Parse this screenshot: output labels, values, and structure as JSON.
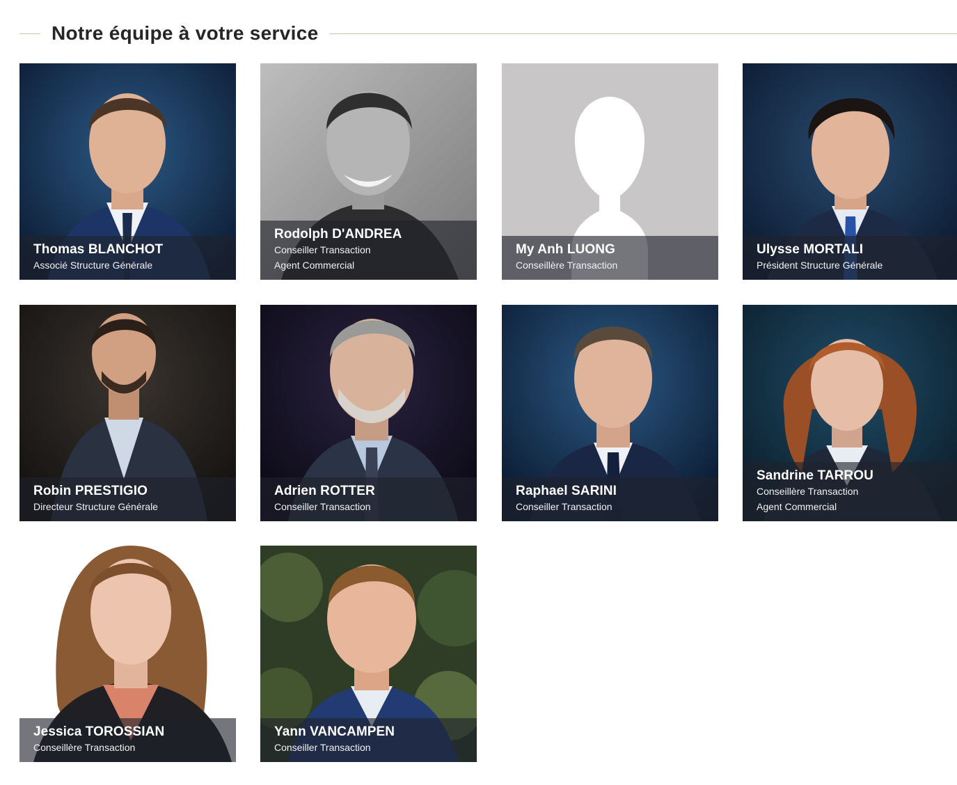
{
  "section": {
    "title": "Notre équipe à votre service"
  },
  "members": [
    {
      "name": "Thomas BLANCHOT",
      "roles": [
        "Associé Structure Générale"
      ]
    },
    {
      "name": "Rodolph D'ANDREA",
      "roles": [
        "Conseiller Transaction",
        "Agent Commercial"
      ]
    },
    {
      "name": "My Anh LUONG",
      "roles": [
        "Conseillère Transaction"
      ]
    },
    {
      "name": "Ulysse MORTALI",
      "roles": [
        "Président Structure Générale"
      ]
    },
    {
      "name": "Robin PRESTIGIO",
      "roles": [
        "Directeur Structure Générale"
      ]
    },
    {
      "name": "Adrien ROTTER",
      "roles": [
        "Conseiller Transaction"
      ]
    },
    {
      "name": "Raphael SARINI",
      "roles": [
        "Conseiller Transaction"
      ]
    },
    {
      "name": "Sandrine TARROU",
      "roles": [
        "Conseillère Transaction",
        "Agent Commercial"
      ]
    },
    {
      "name": "Jessica TOROSSIAN",
      "roles": [
        "Conseillère Transaction"
      ]
    },
    {
      "name": "Yann VANCAMPEN",
      "roles": [
        "Conseiller Transaction"
      ]
    }
  ]
}
